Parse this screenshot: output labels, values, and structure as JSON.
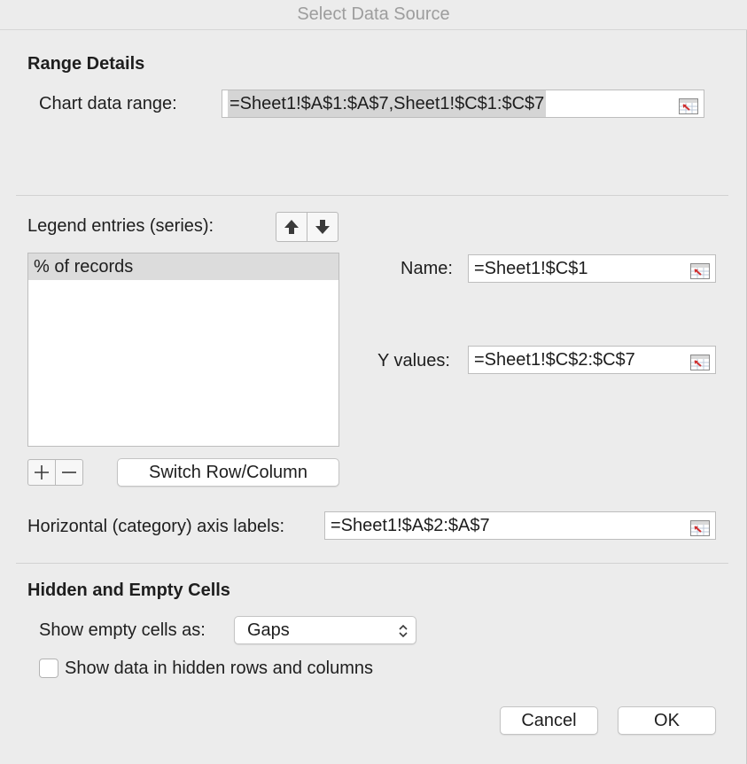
{
  "dialog": {
    "title": "Select Data Source"
  },
  "range_details": {
    "heading": "Range Details",
    "chart_data_range_label": "Chart data range:",
    "chart_data_range_value": "=Sheet1!$A$1:$A$7,Sheet1!$C$1:$C$7"
  },
  "legend": {
    "label": "Legend entries (series):",
    "series": [
      "% of records"
    ],
    "switch_button": "Switch Row/Column"
  },
  "series_details": {
    "name_label": "Name:",
    "name_value": "=Sheet1!$C$1",
    "y_values_label": "Y values:",
    "y_values_value": "=Sheet1!$C$2:$C$7"
  },
  "axis_labels": {
    "label": "Horizontal (category) axis labels:",
    "value": "=Sheet1!$A$2:$A$7"
  },
  "hidden_empty": {
    "heading": "Hidden and Empty Cells",
    "show_empty_label": "Show empty cells as:",
    "show_empty_value": "Gaps",
    "show_hidden_label": "Show data in hidden rows and columns",
    "show_hidden_checked": false
  },
  "buttons": {
    "cancel": "Cancel",
    "ok": "OK"
  },
  "icons": {
    "collapse": "collapse-range-icon",
    "move_up": "arrow-up-icon",
    "move_down": "arrow-down-icon",
    "add": "plus-icon",
    "remove": "minus-icon",
    "select_chevron": "up-down-chevron-icon"
  }
}
